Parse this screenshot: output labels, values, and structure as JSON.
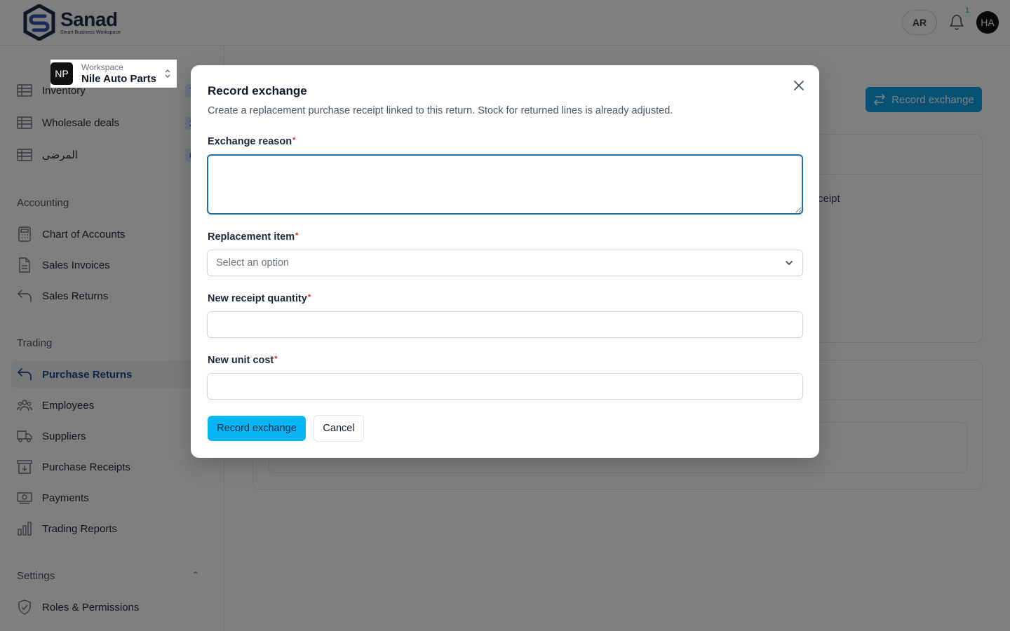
{
  "header": {
    "brand_name": "Sanad",
    "brand_tagline": "Smart Business Workspace",
    "lang_button": "AR",
    "notification_count": "1",
    "avatar_initials": "HA"
  },
  "sidebar": {
    "workspace_label": "Workspace",
    "workspace_name": "Nile Auto Parts",
    "workspace_initials": "NP",
    "items_top": [
      {
        "label": "Inventory",
        "count": "7",
        "icon": "table-icon"
      },
      {
        "label": "Wholesale deals",
        "count": "2",
        "icon": "table-icon"
      },
      {
        "label": "المرضى",
        "count": "0",
        "icon": "table-icon"
      }
    ],
    "sections": {
      "accounting": "Accounting",
      "trading": "Trading",
      "settings": "Settings"
    },
    "accounting_items": [
      {
        "label": "Chart of Accounts",
        "icon": "calculator-icon"
      },
      {
        "label": "Sales Invoices",
        "icon": "document-icon"
      },
      {
        "label": "Sales Returns",
        "icon": "return-arrow-icon"
      }
    ],
    "trading_items": [
      {
        "label": "Purchase Returns",
        "icon": "return-arrow-icon",
        "active": true
      },
      {
        "label": "Employees",
        "icon": "users-icon"
      },
      {
        "label": "Suppliers",
        "icon": "truck-icon"
      },
      {
        "label": "Purchase Receipts",
        "icon": "receipt-icon"
      },
      {
        "label": "Payments",
        "icon": "cash-icon"
      },
      {
        "label": "Trading Reports",
        "icon": "bar-chart-icon"
      }
    ],
    "settings_items": [
      {
        "label": "Roles & Permissions",
        "icon": "shield-icon"
      }
    ]
  },
  "background": {
    "action_button": "Record exchange",
    "card_fragment": "ceipt"
  },
  "modal": {
    "title": "Record exchange",
    "description": "Create a replacement purchase receipt linked to this return. Stock for returned lines is already adjusted.",
    "fields": {
      "exchange_reason": {
        "label": "Exchange reason",
        "value": ""
      },
      "replacement_item": {
        "label": "Replacement item",
        "placeholder": "Select an option"
      },
      "new_receipt_quantity": {
        "label": "New receipt quantity",
        "value": ""
      },
      "new_unit_cost": {
        "label": "New unit cost",
        "value": ""
      }
    },
    "required_marker": "*",
    "submit_label": "Record exchange",
    "cancel_label": "Cancel"
  },
  "colors": {
    "primary": "#06b6f4",
    "brand_navy": "#1e2a4a",
    "focus_border": "#1e6fb0",
    "required": "#dc2626"
  }
}
